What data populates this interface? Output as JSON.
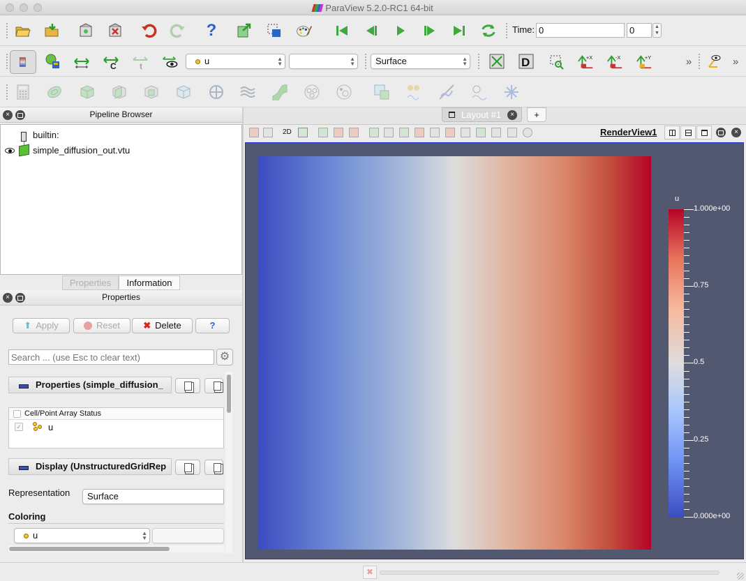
{
  "window": {
    "title": "ParaView 5.2.0-RC1 64-bit"
  },
  "toolbar": {
    "time_label": "Time:",
    "time_value": "0",
    "time_index": "0",
    "color_array": "u",
    "component": "",
    "representation": "Surface"
  },
  "pipeline": {
    "title": "Pipeline Browser",
    "items": [
      {
        "label": "builtin:"
      },
      {
        "label": "simple_diffusion_out.vtu"
      }
    ]
  },
  "tabs": [
    {
      "label": "Properties"
    },
    {
      "label": "Information"
    }
  ],
  "properties": {
    "title": "Properties",
    "apply": "Apply",
    "reset": "Reset",
    "delete": "Delete",
    "help": "?",
    "search_placeholder": "Search ... (use Esc to clear text)",
    "section_properties": "Properties (simple_diffusion_",
    "array_header": "Cell/Point Array Status",
    "array_item": "u",
    "section_display": "Display (UnstructuredGridRep",
    "representation_label": "Representation",
    "representation_value": "Surface",
    "coloring_label": "Coloring",
    "coloring_value": "u"
  },
  "layout": {
    "tab_label": "Layout #1",
    "add_tab": "+",
    "view_name": "RenderView1",
    "toggle_2d": "2D"
  },
  "colorbar": {
    "title": "u",
    "labels": [
      "1.000e+00",
      "0.75",
      "0.5",
      "0.25",
      "0.000e+00"
    ],
    "gradient_low": "#3b4cc0",
    "gradient_mid": "#dddddd",
    "gradient_high": "#b40426"
  },
  "colors": {
    "background": "#525870",
    "active_view_border": "#1d2fd0"
  }
}
